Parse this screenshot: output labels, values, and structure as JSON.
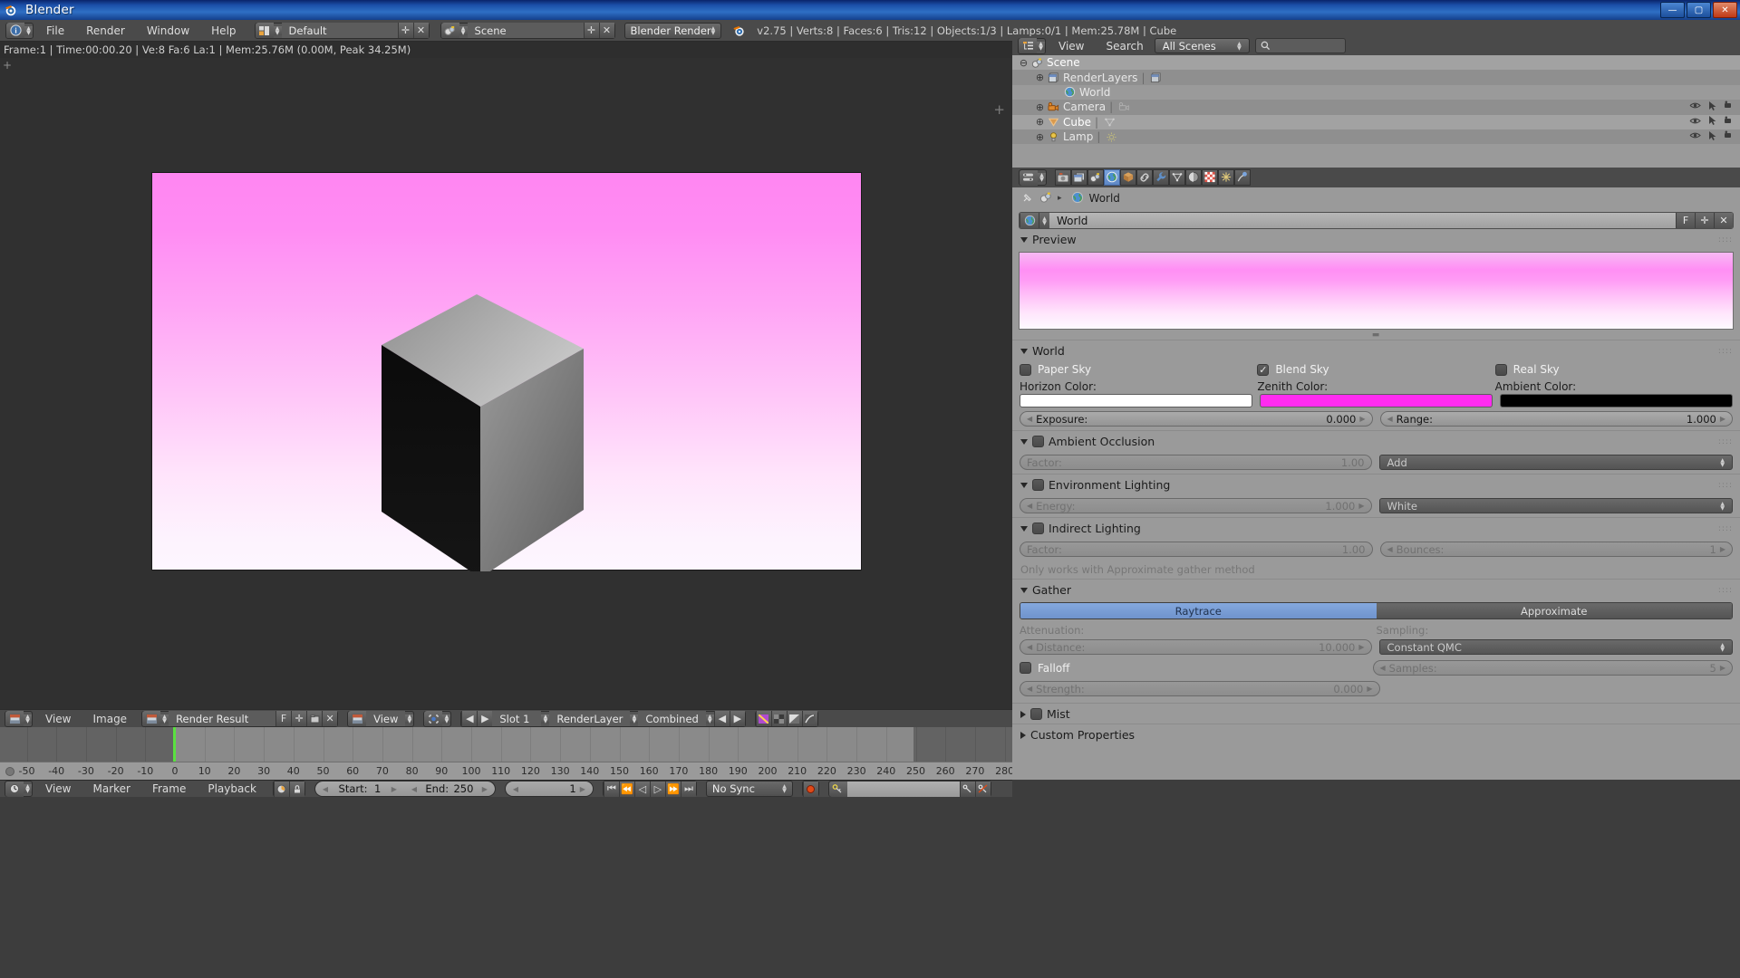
{
  "window": {
    "title": "Blender",
    "app_icon": "blender-logo-icon",
    "minimize": "—",
    "maximize": "▢",
    "close": "✕"
  },
  "topbar": {
    "info_editor_icon": "info-editor-icon",
    "menus": [
      "File",
      "Render",
      "Window",
      "Help"
    ],
    "screen_layout": {
      "icon": "screen-layout-icon",
      "value": "Default",
      "add": "✛",
      "delete": "✕"
    },
    "scene": {
      "icon": "scene-icon",
      "value": "Scene",
      "add": "✛",
      "delete": "✕"
    },
    "engine": {
      "value": "Blender Render"
    },
    "stats": "v2.75 | Verts:8 | Faces:6 | Tris:12 | Objects:1/3 | Lamps:0/1 | Mem:25.78M | Cube"
  },
  "render_info": "Frame:1 | Time:00:00.20 | Ve:8 Fa:6 La:1 | Mem:25.76M (0.00M, Peak 34.25M)",
  "render_view": {
    "horizon_color_hex": "#FFFFFF",
    "zenith_color_hex": "#FF2BF0",
    "cube_label": "Cube"
  },
  "image_header": {
    "editor_icon": "image-editor-icon",
    "menus": [
      "View",
      "Image"
    ],
    "image_datablock": {
      "icon": "image-icon",
      "value": "Render Result",
      "fake_user": "F",
      "new": "✛",
      "open": "📂",
      "unlink": "✕"
    },
    "view_mode": {
      "icon": "image-icon",
      "value": "View"
    },
    "pivot": {
      "icon": "pivot-icon"
    },
    "slot": {
      "prev": "◀",
      "next": "▶",
      "value": "Slot 1"
    },
    "render_layer": {
      "value": "RenderLayer"
    },
    "pass": {
      "value": "Combined",
      "prev": "◀",
      "next": "▶"
    },
    "channel_buttons": [
      "color-and-alpha-icon",
      "alpha-icon",
      "z-buffer-icon",
      "color-management-icon"
    ]
  },
  "timeline": {
    "ruler_labels": [
      "-50",
      "-40",
      "-30",
      "-20",
      "-10",
      "0",
      "10",
      "20",
      "30",
      "40",
      "50",
      "60",
      "70",
      "80",
      "90",
      "100",
      "110",
      "120",
      "130",
      "140",
      "150",
      "160",
      "170",
      "180",
      "190",
      "200",
      "210",
      "220",
      "230",
      "240",
      "250",
      "260",
      "270",
      "280"
    ],
    "current_frame_marker": 1,
    "toolbar": {
      "editor_icon": "timeline-editor-icon",
      "menus": [
        "View",
        "Marker",
        "Frame",
        "Playback"
      ],
      "auto_keying_icon": "record-icon",
      "lock_icon": "lock-icon",
      "start": {
        "label": "Start:",
        "value": "1"
      },
      "end": {
        "label": "End:",
        "value": "250"
      },
      "current": {
        "value": "1"
      },
      "transport": [
        "jump-to-start-icon",
        "jump-prev-keyframe-icon",
        "play-reverse-icon",
        "play-icon",
        "jump-next-keyframe-icon",
        "jump-to-end-icon"
      ],
      "sync_mode": "No Sync",
      "record_icon": "record-red-icon",
      "keying_set": {
        "icon": "key-icon",
        "value": ""
      },
      "insert_keyframe_icon": "key-add-icon",
      "delete_keyframe_icon": "key-remove-icon"
    }
  },
  "outliner": {
    "editor_icon": "outliner-editor-icon",
    "menus": [
      "View",
      "Search"
    ],
    "display_mode": "All Scenes",
    "search_icon": "search-icon",
    "search_value": "",
    "rows": [
      {
        "indent": 0,
        "expander": "−",
        "icon": "scene-icon",
        "label": "Scene",
        "selected": true,
        "data_icon": null
      },
      {
        "indent": 1,
        "expander": "+",
        "icon": "renderlayers-icon",
        "label": "RenderLayers",
        "selected": false,
        "data_icon": "renderlayers-data-icon"
      },
      {
        "indent": 2,
        "expander": "",
        "icon": "world-icon",
        "label": "World",
        "selected": false,
        "data_icon": null
      },
      {
        "indent": 1,
        "expander": "+",
        "icon": "camera-icon",
        "label": "Camera",
        "selected": false,
        "data_icon": "camera-data-icon"
      },
      {
        "indent": 1,
        "expander": "+",
        "icon": "mesh-icon",
        "label": "Cube",
        "selected": true,
        "data_icon": "mesh-data-icon"
      },
      {
        "indent": 1,
        "expander": "+",
        "icon": "lamp-icon",
        "label": "Lamp",
        "selected": false,
        "data_icon": "lamp-data-icon"
      }
    ],
    "restrict_icons": [
      "restrict-view-icon",
      "restrict-select-icon",
      "restrict-render-icon"
    ]
  },
  "properties": {
    "browse_icon": "properties-browse-icon",
    "tabs": [
      {
        "name": "render-tab",
        "icon": "camera-back-icon",
        "active": false
      },
      {
        "name": "render-layers-tab",
        "icon": "renderlayers-icon",
        "active": false
      },
      {
        "name": "scene-tab",
        "icon": "scene-icon",
        "active": false
      },
      {
        "name": "world-tab",
        "icon": "world-icon",
        "active": true
      },
      {
        "name": "object-tab",
        "icon": "object-cube-icon",
        "active": false
      },
      {
        "name": "constraints-tab",
        "icon": "chain-icon",
        "active": false
      },
      {
        "name": "modifiers-tab",
        "icon": "wrench-icon",
        "active": false
      },
      {
        "name": "data-tab",
        "icon": "mesh-data-icon",
        "active": false
      },
      {
        "name": "material-tab",
        "icon": "material-ball-icon",
        "active": false
      },
      {
        "name": "texture-tab",
        "icon": "checker-icon",
        "active": false
      },
      {
        "name": "particles-tab",
        "icon": "particles-icon",
        "active": false
      },
      {
        "name": "physics-tab",
        "icon": "physics-icon",
        "active": false
      }
    ],
    "breadcrumb": {
      "pin_icon": "pin-icon",
      "scene_icon": "scene-icon",
      "sep": "▸",
      "world_icon": "world-icon",
      "world_label": "World"
    },
    "datablock": {
      "icon": "world-icon",
      "value": "World",
      "fake_user": "F",
      "new": "✛",
      "unlink": "✕"
    },
    "panels": {
      "preview": {
        "title": "Preview",
        "open": true
      },
      "world": {
        "title": "World",
        "open": true,
        "paper_sky": {
          "label": "Paper Sky",
          "checked": false
        },
        "blend_sky": {
          "label": "Blend Sky",
          "checked": true
        },
        "real_sky": {
          "label": "Real Sky",
          "checked": false
        },
        "horizon_color": {
          "label": "Horizon Color:",
          "hex": "#FFFFFF"
        },
        "zenith_color": {
          "label": "Zenith Color:",
          "hex": "#FF2BF0"
        },
        "ambient_color": {
          "label": "Ambient Color:",
          "hex": "#000000"
        },
        "exposure": {
          "label": "Exposure:",
          "value": "0.000"
        },
        "range": {
          "label": "Range:",
          "value": "1.000"
        }
      },
      "ambient_occlusion": {
        "title": "Ambient Occlusion",
        "open": true,
        "enabled": false,
        "factor": {
          "label": "Factor:",
          "value": "1.00"
        },
        "blend_mode": "Add"
      },
      "environment_lighting": {
        "title": "Environment Lighting",
        "open": true,
        "enabled": false,
        "energy": {
          "label": "Energy:",
          "value": "1.000"
        },
        "source": "White"
      },
      "indirect_lighting": {
        "title": "Indirect Lighting",
        "open": true,
        "enabled": false,
        "factor": {
          "label": "Factor:",
          "value": "1.00"
        },
        "bounces": {
          "label": "Bounces:",
          "value": "1"
        },
        "note": "Only works with Approximate gather method"
      },
      "gather": {
        "title": "Gather",
        "open": true,
        "method_raytrace": "Raytrace",
        "method_approximate": "Approximate",
        "method_selected": "Raytrace",
        "attenuation_label": "Attenuation:",
        "sampling_label": "Sampling:",
        "distance": {
          "label": "Distance:",
          "value": "10.000"
        },
        "sampling_method": "Constant QMC",
        "falloff": {
          "label": "Falloff",
          "checked": false
        },
        "samples": {
          "label": "Samples:",
          "value": "5"
        },
        "strength": {
          "label": "Strength:",
          "value": "0.000"
        }
      },
      "mist": {
        "title": "Mist",
        "open": false
      },
      "custom_properties": {
        "title": "Custom Properties",
        "open": false
      }
    }
  }
}
